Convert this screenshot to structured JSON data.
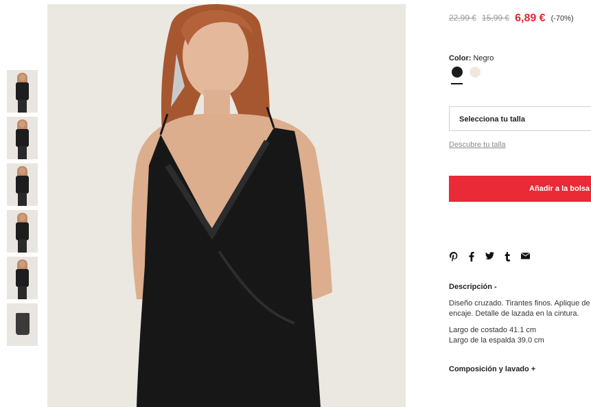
{
  "product": {
    "price": {
      "original_1": "22,99 €",
      "original_2": "15,99 €",
      "current": "6,89 €",
      "discount": "(-70%)"
    },
    "color": {
      "label": "Color:",
      "value": "Negro",
      "swatches": [
        {
          "name": "Negro",
          "hex": "#1b1b1b"
        },
        {
          "name": "Crudo",
          "hex": "#efe9dd"
        }
      ]
    },
    "size_select": "Selecciona tu talla",
    "size_link": "Descubre tu talla",
    "add_to_bag": "Añadir a la bolsa",
    "share_icons": [
      "pinterest-icon",
      "facebook-icon",
      "twitter-icon",
      "tumblr-icon",
      "email-icon"
    ],
    "description": {
      "title": "Descripción -",
      "text": "Diseño cruzado. Tirantes finos. Aplique de encaje. Detalle de lazada en la cintura.",
      "measurements": [
        "Largo de costado 41.1 cm",
        "Largo de la espalda 39.0 cm"
      ]
    },
    "composition_title": "Composición y lavado +"
  },
  "gallery": {
    "thumbnails": [
      "thumb-1",
      "thumb-2",
      "thumb-3",
      "thumb-4",
      "thumb-5",
      "thumb-6"
    ]
  },
  "colors": {
    "accent": "#ea2a36",
    "sale_price": "#e0262f",
    "background": "#ffffff"
  }
}
